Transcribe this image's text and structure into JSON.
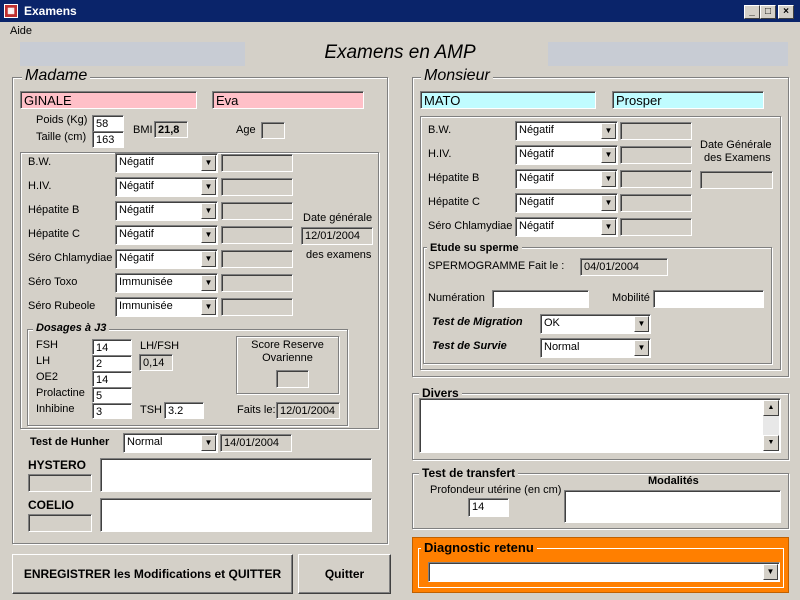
{
  "window": {
    "title": "Examens",
    "min": "_",
    "max": "□",
    "close": "×"
  },
  "menu": {
    "aide": "Aide"
  },
  "header": {
    "title": "Examens  en AMP"
  },
  "madame": {
    "group_title": "Madame",
    "nom": "GINALE",
    "prenom": "Eva",
    "poids_label": "Poids (Kg)",
    "poids": "58",
    "taille_label": "Taille (cm)",
    "taille": "163",
    "bmi_label": "BMI",
    "bmi": "21,8",
    "age_label": "Age",
    "age": "",
    "serologies": [
      {
        "label": "B.W.",
        "value": "Négatif"
      },
      {
        "label": "H.IV.",
        "value": "Négatif"
      },
      {
        "label": "Hépatite B",
        "value": "Négatif"
      },
      {
        "label": "Hépatite C",
        "value": "Négatif"
      },
      {
        "label": "Séro Chlamydiae",
        "value": "Négatif"
      },
      {
        "label": "Séro Toxo",
        "value": "Immunisée"
      },
      {
        "label": "Séro Rubeole",
        "value": "Immunisée"
      }
    ],
    "date_gen_label1": "Date générale",
    "date_gen": "12/01/2004",
    "date_gen_label2": "des examens",
    "dosages": {
      "title": "Dosages à J3",
      "fsh_label": "FSH",
      "fsh": "14",
      "lh_label": "LH",
      "lh": "2",
      "oe2_label": "OE2",
      "oe2": "14",
      "prolactine_label": "Prolactine",
      "prolactine": "5",
      "inhibine_label": "Inhibine",
      "inhibine": "3",
      "lhfsh_label": "LH/FSH",
      "lhfsh": "0,14",
      "tsh_label": "TSH",
      "tsh": "3.2",
      "score_label1": "Score Reserve",
      "score_label2": "Ovarienne",
      "score": "",
      "faits_label": "Faits le:",
      "faits": "12/01/2004"
    },
    "hunher_label": "Test de Hunher",
    "hunher": "Normal",
    "hunher_date": "14/01/2004",
    "hystero_label": "HYSTERO",
    "coelio_label": "COELIO"
  },
  "monsieur": {
    "group_title": "Monsieur",
    "nom": "MATO",
    "prenom": "Prosper",
    "serologies": [
      {
        "label": "B.W.",
        "value": "Négatif"
      },
      {
        "label": "H.IV.",
        "value": "Négatif"
      },
      {
        "label": "Hépatite B",
        "value": "Négatif"
      },
      {
        "label": "Hépatite C",
        "value": "Négatif"
      },
      {
        "label": "Séro Chlamydiae",
        "value": "Négatif"
      }
    ],
    "date_gen_label1": "Date Générale",
    "date_gen_label2": "des Examens",
    "date_gen": "",
    "sperme": {
      "title": "Etude su sperme",
      "spermo_label": "SPERMOGRAMME Fait le :",
      "spermo_date": "04/01/2004",
      "numeration_label": "Numération",
      "mobilite_label": "Mobilité",
      "migration_label": "Test de Migration",
      "migration": "OK",
      "survie_label": "Test de Survie",
      "survie": "Normal"
    }
  },
  "divers": {
    "title": "Divers"
  },
  "transfert": {
    "title": "Test de transfert",
    "profondeur_label": "Profondeur utérine (en cm)",
    "profondeur": "14",
    "modalites_label": "Modalités"
  },
  "diagnostic": {
    "title": "Diagnostic retenu",
    "value": "",
    "accent": "#ff7f00"
  },
  "buttons": {
    "save": "ENREGISTRER les Modifications et QUITTER",
    "quit": "Quitter"
  }
}
